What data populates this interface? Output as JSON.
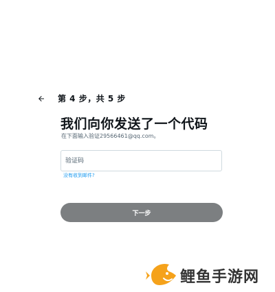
{
  "header": {
    "back_icon": "arrow-left-icon",
    "step_label": "第 4 步，共 5 步"
  },
  "main": {
    "title": "我们向你发送了一个代码",
    "subtitle": "在下面输入验证29566461@qq.com。",
    "code_input": {
      "placeholder": "验证码",
      "value": ""
    },
    "help_link": "没有收到邮件?",
    "next_button": "下一步"
  },
  "watermark": {
    "text": "鲤鱼手游网",
    "logo_icon": "fish-logo-icon"
  },
  "colors": {
    "text_primary": "#0f1419",
    "text_secondary": "#536471",
    "link": "#1d9bf0",
    "button_disabled": "#7c7f81",
    "logo_orange": "#f5a21b"
  }
}
